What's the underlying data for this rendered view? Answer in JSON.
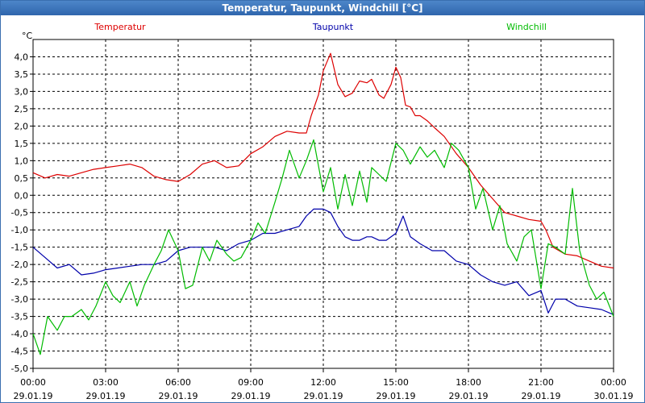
{
  "window": {
    "title": "Temperatur, Taupunkt, Windchill [°C]"
  },
  "chart_data": {
    "type": "line",
    "title": "Temperatur, Taupunkt, Windchill [°C]",
    "ylabel": "°C",
    "ylim": [
      -5.0,
      4.5
    ],
    "xlim": [
      0,
      24
    ],
    "grid": true,
    "legend_position": "top",
    "y_ticks": [
      "4,0",
      "3,5",
      "3,0",
      "2,5",
      "2,0",
      "1,5",
      "1,0",
      "0,5",
      "0,0",
      "-0,5",
      "-1,0",
      "-1,5",
      "-2,0",
      "-2,5",
      "-3,0",
      "-3,5",
      "-4,0",
      "-4,5",
      "-5,0"
    ],
    "x_ticks": [
      {
        "time": "00:00",
        "date": "29.01.19"
      },
      {
        "time": "03:00",
        "date": "29.01.19"
      },
      {
        "time": "06:00",
        "date": "29.01.19"
      },
      {
        "time": "09:00",
        "date": "29.01.19"
      },
      {
        "time": "12:00",
        "date": "29.01.19"
      },
      {
        "time": "15:00",
        "date": "29.01.19"
      },
      {
        "time": "18:00",
        "date": "29.01.19"
      },
      {
        "time": "21:00",
        "date": "29.01.19"
      },
      {
        "time": "00:00",
        "date": "30.01.19"
      }
    ],
    "series": [
      {
        "name": "Temperatur",
        "color": "#dd0000",
        "x": [
          0,
          0.5,
          1,
          1.5,
          2,
          2.5,
          3,
          3.5,
          4,
          4.5,
          5,
          5.5,
          6,
          6.5,
          7,
          7.5,
          8,
          8.5,
          9,
          9.5,
          10,
          10.5,
          11,
          11.3,
          11.5,
          11.8,
          12,
          12.3,
          12.6,
          12.9,
          13.2,
          13.5,
          13.8,
          14,
          14.3,
          14.5,
          14.8,
          15,
          15.2,
          15.4,
          15.6,
          15.8,
          16,
          16.3,
          16.6,
          17,
          17.5,
          18,
          18.5,
          19,
          19.5,
          20,
          20.5,
          21,
          21.2,
          21.5,
          22,
          22.5,
          23,
          23.5,
          24
        ],
        "y": [
          0.65,
          0.5,
          0.6,
          0.55,
          0.65,
          0.75,
          0.8,
          0.85,
          0.9,
          0.8,
          0.55,
          0.45,
          0.4,
          0.6,
          0.9,
          1.0,
          0.8,
          0.85,
          1.2,
          1.4,
          1.7,
          1.85,
          1.8,
          1.8,
          2.3,
          2.9,
          3.6,
          4.1,
          3.2,
          2.85,
          2.95,
          3.3,
          3.25,
          3.35,
          2.9,
          2.8,
          3.2,
          3.7,
          3.4,
          2.6,
          2.55,
          2.3,
          2.3,
          2.15,
          1.95,
          1.7,
          1.2,
          0.8,
          0.3,
          -0.1,
          -0.5,
          -0.6,
          -0.7,
          -0.75,
          -1.0,
          -1.5,
          -1.7,
          -1.75,
          -1.9,
          -2.05,
          -2.1
        ]
      },
      {
        "name": "Taupunkt",
        "color": "#0000aa",
        "x": [
          0,
          0.5,
          1,
          1.5,
          2,
          2.5,
          3,
          3.5,
          4,
          4.5,
          5,
          5.5,
          6,
          6.5,
          7,
          7.5,
          8,
          8.5,
          9,
          9.5,
          10,
          10.5,
          11,
          11.3,
          11.6,
          12,
          12.3,
          12.6,
          12.9,
          13.2,
          13.5,
          13.8,
          14,
          14.3,
          14.6,
          15,
          15.3,
          15.6,
          16,
          16.5,
          17,
          17.5,
          18,
          18.5,
          19,
          19.5,
          20,
          20.5,
          21,
          21.3,
          21.6,
          22,
          22.5,
          23,
          23.5,
          24
        ],
        "y": [
          -1.5,
          -1.8,
          -2.1,
          -2.0,
          -2.3,
          -2.25,
          -2.15,
          -2.1,
          -2.05,
          -2.0,
          -2.0,
          -1.9,
          -1.6,
          -1.5,
          -1.5,
          -1.5,
          -1.6,
          -1.4,
          -1.3,
          -1.1,
          -1.1,
          -1.0,
          -0.9,
          -0.6,
          -0.4,
          -0.4,
          -0.5,
          -0.9,
          -1.2,
          -1.3,
          -1.3,
          -1.2,
          -1.2,
          -1.3,
          -1.3,
          -1.1,
          -0.6,
          -1.2,
          -1.4,
          -1.6,
          -1.6,
          -1.9,
          -2.0,
          -2.3,
          -2.5,
          -2.6,
          -2.5,
          -2.9,
          -2.75,
          -3.4,
          -3.0,
          -3.0,
          -3.2,
          -3.25,
          -3.3,
          -3.45
        ]
      },
      {
        "name": "Windchill",
        "color": "#00bb00",
        "x": [
          0,
          0.3,
          0.6,
          1,
          1.3,
          1.6,
          2,
          2.3,
          2.6,
          3,
          3.3,
          3.6,
          4,
          4.3,
          4.6,
          5,
          5.3,
          5.6,
          6,
          6.3,
          6.6,
          7,
          7.3,
          7.6,
          8,
          8.3,
          8.6,
          9,
          9.3,
          9.6,
          10,
          10.3,
          10.6,
          11,
          11.3,
          11.6,
          12,
          12.3,
          12.6,
          12.9,
          13.2,
          13.5,
          13.8,
          14,
          14.3,
          14.6,
          15,
          15.3,
          15.6,
          16,
          16.3,
          16.6,
          17,
          17.3,
          17.6,
          18,
          18.3,
          18.6,
          19,
          19.3,
          19.6,
          20,
          20.3,
          20.6,
          21,
          21.3,
          21.6,
          22,
          22.3,
          22.6,
          23,
          23.3,
          23.6,
          24
        ],
        "y": [
          -4.0,
          -4.6,
          -3.5,
          -3.9,
          -3.5,
          -3.5,
          -3.3,
          -3.6,
          -3.2,
          -2.5,
          -2.9,
          -3.1,
          -2.5,
          -3.2,
          -2.6,
          -2.0,
          -1.6,
          -1.0,
          -1.6,
          -2.7,
          -2.6,
          -1.5,
          -1.9,
          -1.3,
          -1.7,
          -1.9,
          -1.8,
          -1.3,
          -0.8,
          -1.1,
          -0.2,
          0.5,
          1.3,
          0.5,
          1.0,
          1.6,
          0.1,
          0.8,
          -0.4,
          0.6,
          -0.3,
          0.7,
          -0.2,
          0.8,
          0.6,
          0.4,
          1.5,
          1.3,
          0.9,
          1.4,
          1.1,
          1.3,
          0.8,
          1.5,
          1.3,
          0.8,
          -0.4,
          0.2,
          -1.0,
          -0.3,
          -1.4,
          -1.9,
          -1.2,
          -1.0,
          -2.7,
          -1.4,
          -1.5,
          -1.7,
          0.2,
          -1.6,
          -2.6,
          -3.0,
          -2.8,
          -3.5
        ]
      }
    ]
  }
}
